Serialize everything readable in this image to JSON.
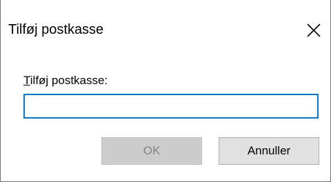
{
  "dialog": {
    "title": "Tilføj postkasse",
    "close_icon": "close-icon"
  },
  "form": {
    "label_mnemonic": "T",
    "label_rest": "ilføj postkasse:",
    "input_value": ""
  },
  "buttons": {
    "ok_label": "OK",
    "ok_enabled": false,
    "cancel_label": "Annuller"
  },
  "colors": {
    "input_focus_border": "#0078d7",
    "disabled_button_bg": "#cccccc",
    "disabled_button_text": "#838383",
    "button_bg": "#e1e1e1"
  }
}
